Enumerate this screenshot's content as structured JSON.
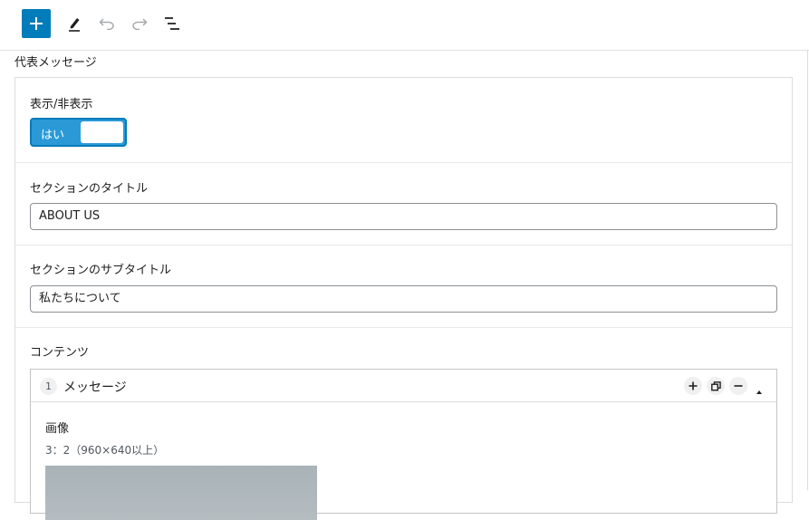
{
  "toolbar": {
    "add_icon": "plus-icon",
    "edit_icon": "pencil-icon",
    "undo_icon": "undo-icon",
    "redo_icon": "redo-icon",
    "outline_icon": "list-outline-icon",
    "accent_color": "#007cba"
  },
  "section": {
    "label": "代表メッセージ"
  },
  "fields": {
    "visibility": {
      "label": "表示/非表示",
      "toggle_label": "はい",
      "enabled": true
    },
    "title": {
      "label": "セクションのタイトル",
      "value": "ABOUT US"
    },
    "subtitle": {
      "label": "セクションのサブタイトル",
      "value": "私たちについて"
    },
    "contents": {
      "label": "コンテンツ",
      "items": [
        {
          "index": "1",
          "title": "メッセージ",
          "image_label": "画像",
          "image_hint": "3：2（960×640以上）"
        }
      ]
    }
  }
}
